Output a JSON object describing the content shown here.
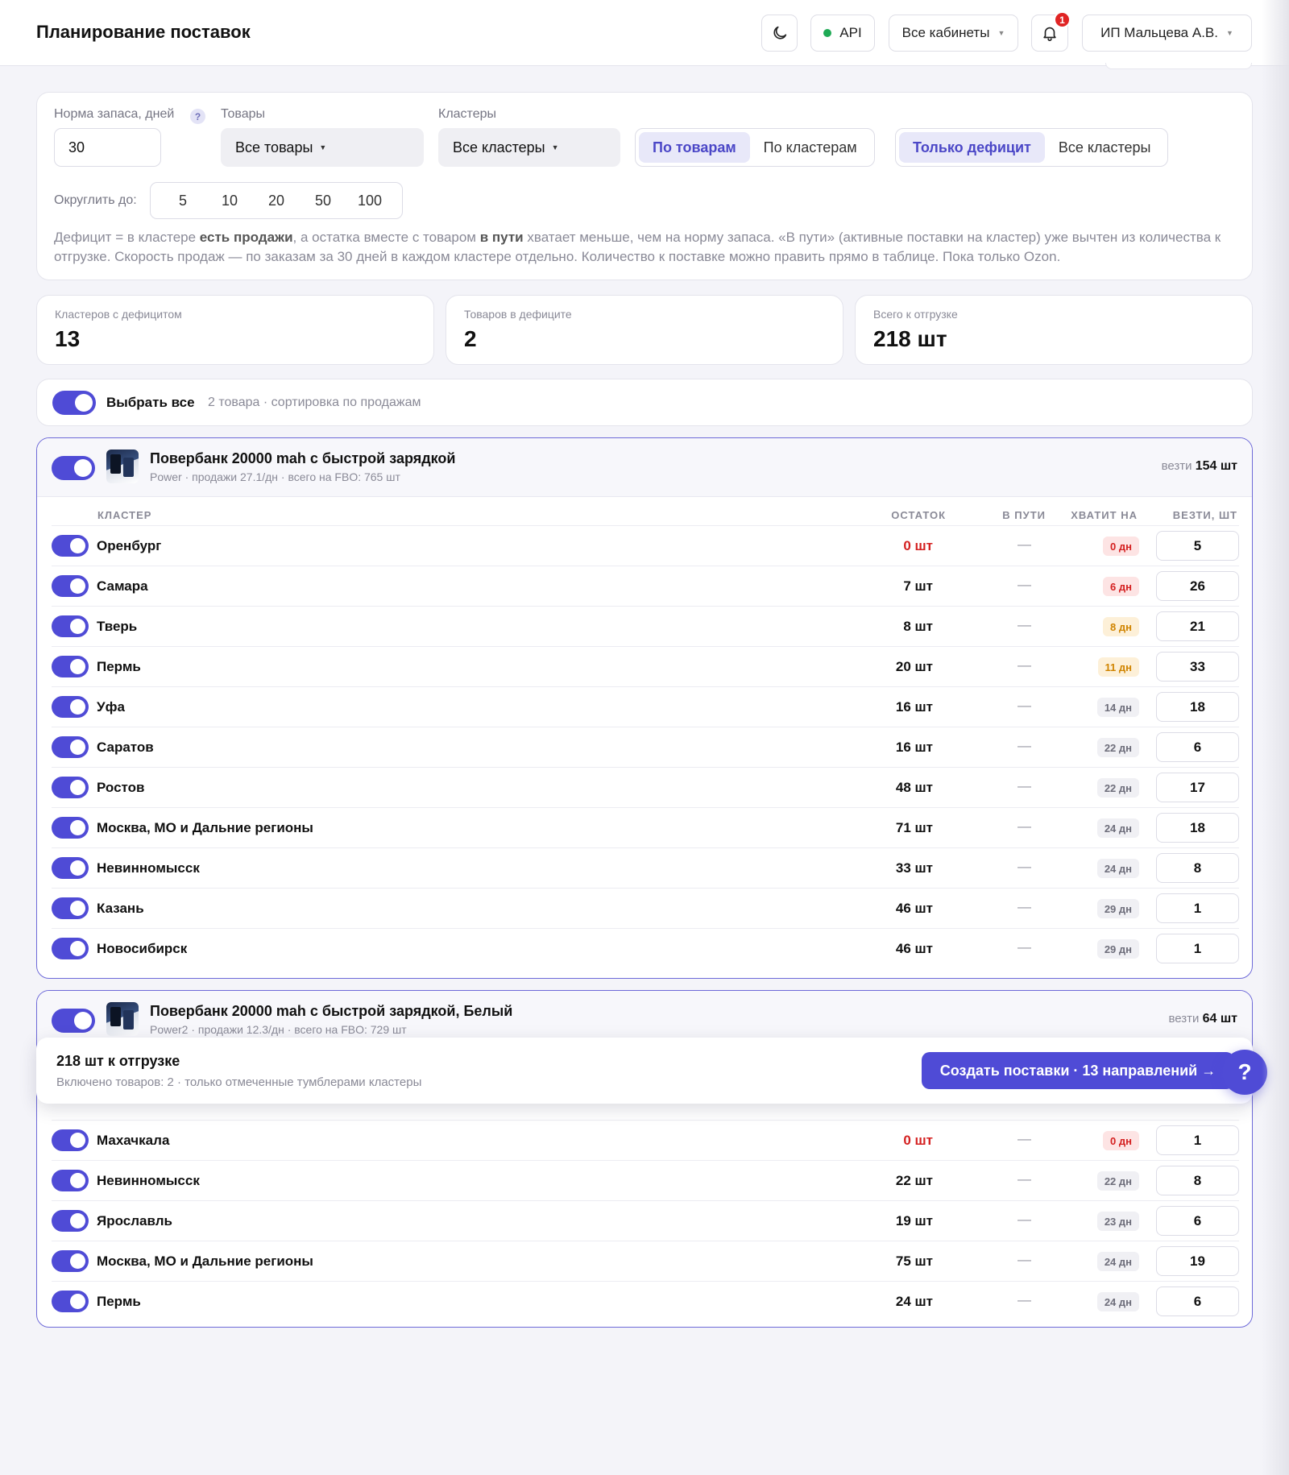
{
  "header": {
    "title": "Планирование поставок",
    "api_label": "API",
    "cabinets_label": "Все кабинеты",
    "notifications_count": "1",
    "user_label": "ИП Мальцева А.В."
  },
  "filters": {
    "stock_norm_label": "Норма запаса, дней",
    "stock_norm_help": "?",
    "stock_norm_value": "30",
    "products_label": "Товары",
    "products_value": "Все товары",
    "clusters_label": "Кластеры",
    "clusters_value": "Все кластеры",
    "view_toggle": [
      "По товарам",
      "По кластерам"
    ],
    "view_selected": "По товарам",
    "scope_toggle": [
      "Только дефицит",
      "Все кластеры"
    ],
    "scope_selected": "Только дефицит",
    "round_label": "Округлить до:",
    "round_options": [
      "5",
      "10",
      "20",
      "50",
      "100"
    ],
    "note": {
      "p1": "Дефицит = в кластере ",
      "b1": "есть продажи",
      "p2": ", а остатка вместе с товаром ",
      "b2": "в пути",
      "p3": " хватает меньше, чем на норму запаса. «В пути» (активные поставки на кластер) уже вычтен из количества к отгрузке. Скорость продаж — по заказам за 30 дней в каждом кластере отдельно. Количество к поставке можно править прямо в таблице. Пока только Ozon."
    }
  },
  "stats": [
    {
      "label": "Кластеров с дефицитом",
      "value": "13"
    },
    {
      "label": "Товаров в дефиците",
      "value": "2"
    },
    {
      "label": "Всего к отгрузке",
      "value": "218 шт"
    }
  ],
  "select_all": {
    "label": "Выбрать все",
    "meta": "2 товара · сортировка по продажам"
  },
  "table_headers": {
    "cluster": "КЛАСТЕР",
    "stock": "ОСТАТОК",
    "transit": "В ПУТИ",
    "enough": "ХВАТИТ НА",
    "carry": "ВЕЗТИ, ШТ"
  },
  "products": [
    {
      "name": "Повербанк 20000 mah с быстрой зарядкой",
      "meta": "Power · продажи 27.1/дн · всего на FBO: 765 шт",
      "carry_label": "везти",
      "carry_value": "154 шт",
      "rows": [
        {
          "cluster": "Оренбург",
          "stock": "0 шт",
          "transit": "—",
          "days": "0 дн",
          "qty": "5"
        },
        {
          "cluster": "Самара",
          "stock": "7 шт",
          "transit": "—",
          "days": "6 дн",
          "qty": "26"
        },
        {
          "cluster": "Тверь",
          "stock": "8 шт",
          "transit": "—",
          "days": "8 дн",
          "qty": "21"
        },
        {
          "cluster": "Пермь",
          "stock": "20 шт",
          "transit": "—",
          "days": "11 дн",
          "qty": "33"
        },
        {
          "cluster": "Уфа",
          "stock": "16 шт",
          "transit": "—",
          "days": "14 дн",
          "qty": "18"
        },
        {
          "cluster": "Саратов",
          "stock": "16 шт",
          "transit": "—",
          "days": "22 дн",
          "qty": "6"
        },
        {
          "cluster": "Ростов",
          "stock": "48 шт",
          "transit": "—",
          "days": "22 дн",
          "qty": "17"
        },
        {
          "cluster": "Москва, МО и Дальние регионы",
          "stock": "71 шт",
          "transit": "—",
          "days": "24 дн",
          "qty": "18"
        },
        {
          "cluster": "Невинномысск",
          "stock": "33 шт",
          "transit": "—",
          "days": "24 дн",
          "qty": "8"
        },
        {
          "cluster": "Казань",
          "stock": "46 шт",
          "transit": "—",
          "days": "29 дн",
          "qty": "1"
        },
        {
          "cluster": "Новосибирск",
          "stock": "46 шт",
          "transit": "—",
          "days": "29 дн",
          "qty": "1"
        }
      ]
    },
    {
      "name": "Повербанк 20000 mah с быстрой зарядкой, Белый",
      "meta": "Power2 · продажи 12.3/дн · всего на FBO: 729 шт",
      "carry_label": "везти",
      "carry_value": "64 шт",
      "rows": [
        {
          "cluster": "Махачкала",
          "stock": "0 шт",
          "transit": "—",
          "days": "0 дн",
          "qty": "1"
        },
        {
          "cluster": "Невинномысск",
          "stock": "22 шт",
          "transit": "—",
          "days": "22 дн",
          "qty": "8"
        },
        {
          "cluster": "Ярославль",
          "stock": "19 шт",
          "transit": "—",
          "days": "23 дн",
          "qty": "6"
        },
        {
          "cluster": "Москва, МО и Дальние регионы",
          "stock": "75 шт",
          "transit": "—",
          "days": "24 дн",
          "qty": "19"
        },
        {
          "cluster": "Пермь",
          "stock": "24 шт",
          "transit": "—",
          "days": "24 дн",
          "qty": "6"
        }
      ]
    }
  ],
  "footer": {
    "title": "218 шт к отгрузке",
    "subtitle": "Включено товаров: 2 · только отмеченные тумблерами кластеры",
    "cta": "Создать поставки · 13 направлений →",
    "help": "?"
  },
  "colors": {
    "accent": "#4f4bd6",
    "deficit_red": "#d42020",
    "warning_orange": "#d08400"
  }
}
